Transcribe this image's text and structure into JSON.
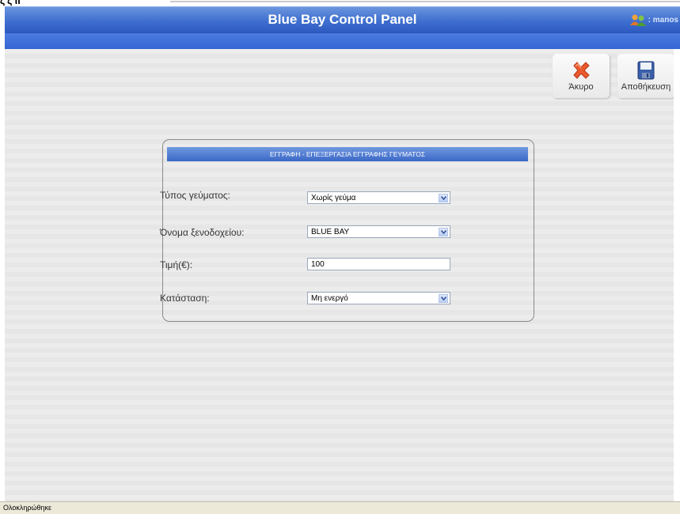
{
  "window": {
    "top_chars": "ζ'ζ ιι",
    "title": "Blue Bay Control Panel",
    "user_label": ": manos"
  },
  "toolbar": {
    "cancel_label": "Άκυρο",
    "save_label": "Αποθήκευση"
  },
  "form": {
    "header": "ΕΓΓΡΑΦΗ - ΕΠΕΞΕΡΓΑΣΙΑ ΕΓΓΡΑΦΗΣ ΓΕΥΜΑΤΟΣ",
    "meal_type_label": "Τύπος γεύματος:",
    "meal_type_value": "Χωρίς γεύμα",
    "hotel_label": "Όνομα ξενοδοχείου:",
    "hotel_value": "BLUE BAY",
    "price_label": "Τιμή(€):",
    "price_value": "100",
    "status_label": "Κατάσταση:",
    "status_value": "Μη ενεργό"
  },
  "statusbar": {
    "text": "Ολοκληρώθηκε"
  },
  "colors": {
    "title_bar": "#3f6fcf",
    "form_header": "#4f7ad2",
    "cancel_icon": "#e8552a"
  }
}
